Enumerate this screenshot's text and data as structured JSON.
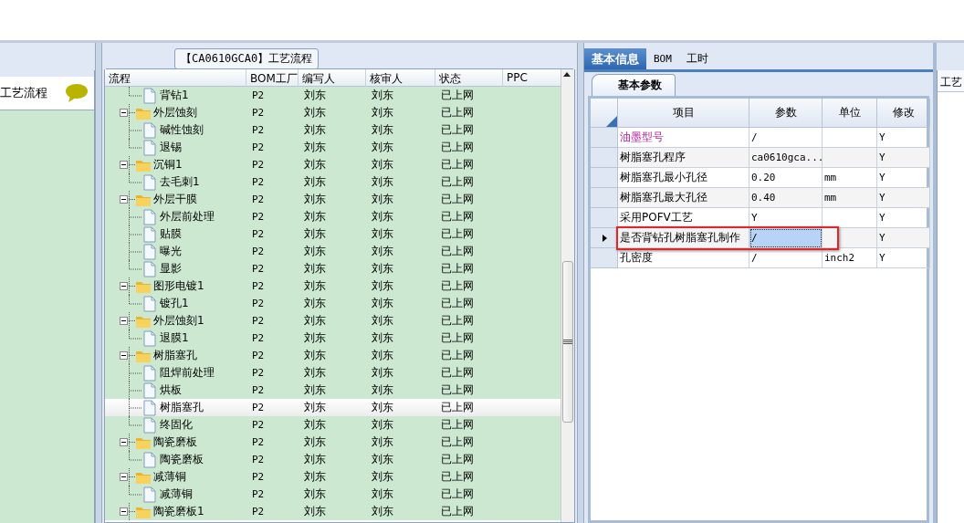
{
  "sidebar": {
    "title": "工艺流程"
  },
  "process_panel": {
    "title": "【CA0610GCA0】工艺流程",
    "columns": [
      "流程",
      "BOM工厂",
      "编写人",
      "核审人",
      "状态",
      "PPC"
    ],
    "tree": [
      {
        "kind": "continued",
        "children": [
          {
            "label": "背钻1",
            "kind": "step",
            "bom": "P2",
            "writer": "刘东",
            "reviewer": "刘东",
            "status": "已上网",
            "selected": false
          }
        ]
      },
      {
        "label": "外层蚀刻",
        "kind": "group",
        "expanded": true,
        "bom": "P2",
        "writer": "刘东",
        "reviewer": "刘东",
        "status": "已上网",
        "selected": false,
        "children": [
          {
            "label": "碱性蚀刻",
            "kind": "step",
            "bom": "P2",
            "writer": "刘东",
            "reviewer": "刘东",
            "status": "已上网",
            "selected": false
          },
          {
            "label": "退锡",
            "kind": "step",
            "bom": "P2",
            "writer": "刘东",
            "reviewer": "刘东",
            "status": "已上网",
            "selected": false
          }
        ]
      },
      {
        "label": "沉铜1",
        "kind": "group",
        "expanded": true,
        "bom": "P2",
        "writer": "刘东",
        "reviewer": "刘东",
        "status": "已上网",
        "selected": false,
        "children": [
          {
            "label": "去毛刺1",
            "kind": "step",
            "bom": "P2",
            "writer": "刘东",
            "reviewer": "刘东",
            "status": "已上网",
            "selected": false
          }
        ]
      },
      {
        "label": "外层干膜",
        "kind": "group",
        "expanded": true,
        "bom": "P2",
        "writer": "刘东",
        "reviewer": "刘东",
        "status": "已上网",
        "selected": false,
        "children": [
          {
            "label": "外层前处理",
            "kind": "step",
            "bom": "P2",
            "writer": "刘东",
            "reviewer": "刘东",
            "status": "已上网",
            "selected": false
          },
          {
            "label": "贴膜",
            "kind": "step",
            "bom": "P2",
            "writer": "刘东",
            "reviewer": "刘东",
            "status": "已上网",
            "selected": false
          },
          {
            "label": "曝光",
            "kind": "step",
            "bom": "P2",
            "writer": "刘东",
            "reviewer": "刘东",
            "status": "已上网",
            "selected": false
          },
          {
            "label": "显影",
            "kind": "step",
            "bom": "P2",
            "writer": "刘东",
            "reviewer": "刘东",
            "status": "已上网",
            "selected": false
          }
        ]
      },
      {
        "label": "图形电镀1",
        "kind": "group",
        "expanded": true,
        "bom": "P2",
        "writer": "刘东",
        "reviewer": "刘东",
        "status": "已上网",
        "selected": false,
        "children": [
          {
            "label": "镀孔1",
            "kind": "step",
            "bom": "P2",
            "writer": "刘东",
            "reviewer": "刘东",
            "status": "已上网",
            "selected": false
          }
        ]
      },
      {
        "label": "外层蚀刻1",
        "kind": "group",
        "expanded": true,
        "bom": "P2",
        "writer": "刘东",
        "reviewer": "刘东",
        "status": "已上网",
        "selected": false,
        "children": [
          {
            "label": "退膜1",
            "kind": "step",
            "bom": "P2",
            "writer": "刘东",
            "reviewer": "刘东",
            "status": "已上网",
            "selected": false
          }
        ]
      },
      {
        "label": "树脂塞孔",
        "kind": "group",
        "expanded": true,
        "bom": "P2",
        "writer": "刘东",
        "reviewer": "刘东",
        "status": "已上网",
        "selected": false,
        "children": [
          {
            "label": "阻焊前处理",
            "kind": "step",
            "bom": "P2",
            "writer": "刘东",
            "reviewer": "刘东",
            "status": "已上网",
            "selected": false
          },
          {
            "label": "烘板",
            "kind": "step",
            "bom": "P2",
            "writer": "刘东",
            "reviewer": "刘东",
            "status": "已上网",
            "selected": false
          },
          {
            "label": "树脂塞孔",
            "kind": "step",
            "bom": "P2",
            "writer": "刘东",
            "reviewer": "刘东",
            "status": "已上网",
            "selected": true
          },
          {
            "label": "终固化",
            "kind": "step",
            "bom": "P2",
            "writer": "刘东",
            "reviewer": "刘东",
            "status": "已上网",
            "selected": false
          }
        ]
      },
      {
        "label": "陶瓷磨板",
        "kind": "group",
        "expanded": true,
        "bom": "P2",
        "writer": "刘东",
        "reviewer": "刘东",
        "status": "已上网",
        "selected": false,
        "children": [
          {
            "label": "陶瓷磨板",
            "kind": "step",
            "bom": "P2",
            "writer": "刘东",
            "reviewer": "刘东",
            "status": "已上网",
            "selected": false
          }
        ]
      },
      {
        "label": "减薄铜",
        "kind": "group",
        "expanded": true,
        "bom": "P2",
        "writer": "刘东",
        "reviewer": "刘东",
        "status": "已上网",
        "selected": false,
        "children": [
          {
            "label": "减薄铜",
            "kind": "step",
            "bom": "P2",
            "writer": "刘东",
            "reviewer": "刘东",
            "status": "已上网",
            "selected": false
          }
        ]
      },
      {
        "label": "陶瓷磨板1",
        "kind": "group",
        "expanded": true,
        "bom": "P2",
        "writer": "刘东",
        "reviewer": "刘东",
        "status": "已上网",
        "selected": false
      }
    ]
  },
  "info_panel": {
    "tabs": [
      {
        "label": "基本信息",
        "selected": true
      },
      {
        "label": "BOM",
        "selected": false
      },
      {
        "label": "工时",
        "selected": false
      }
    ],
    "subtab": "基本参数",
    "columns": [
      "项目",
      "参数",
      "单位",
      "修改"
    ],
    "rows": [
      {
        "item": "油墨型号",
        "highlighted": true,
        "param": "/",
        "modify": "Y",
        "selected": false
      },
      {
        "item": "树脂塞孔程序",
        "highlighted": false,
        "param": "ca0610gca...",
        "modify": "Y",
        "selected": false
      },
      {
        "item": "树脂塞孔最小孔径",
        "highlighted": false,
        "param": "0.20",
        "unit": "mm",
        "modify": "Y",
        "selected": false
      },
      {
        "item": "树脂塞孔最大孔径",
        "highlighted": false,
        "param": "0.40",
        "unit": "mm",
        "modify": "Y",
        "selected": false
      },
      {
        "item": "采用POFV工艺",
        "highlighted": false,
        "param": "Y",
        "modify": "Y",
        "selected": false
      },
      {
        "item": "是否背钻孔树脂塞孔制作",
        "highlighted": false,
        "param": "/",
        "modify": "Y",
        "selected": true
      },
      {
        "item": "孔密度",
        "highlighted": false,
        "param": "/",
        "unit": "inch2",
        "modify": "Y",
        "selected": false
      }
    ]
  },
  "far_panel": {
    "title": "工艺"
  }
}
